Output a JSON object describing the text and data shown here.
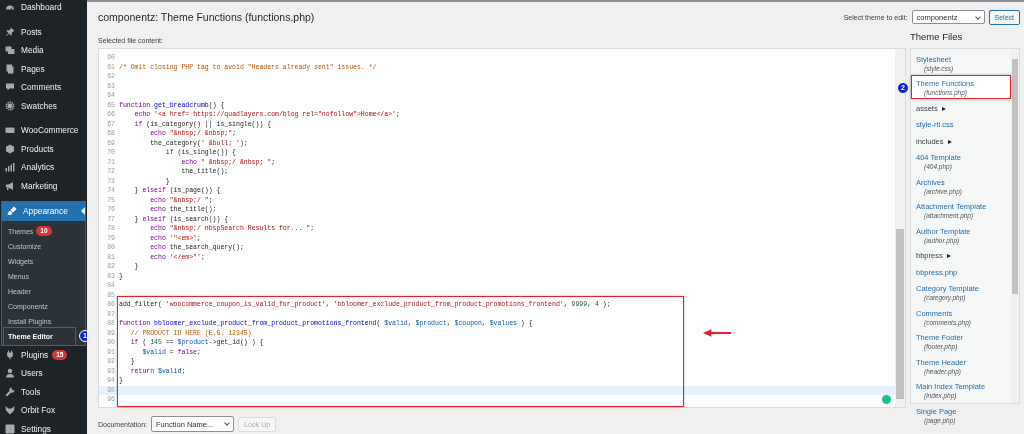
{
  "sidebar": {
    "menu_groups": [
      {
        "items": [
          {
            "label": "Dashboard",
            "current": false
          }
        ]
      },
      {
        "items": [
          {
            "label": "Posts",
            "current": false
          },
          {
            "label": "Media",
            "current": false
          },
          {
            "label": "Pages",
            "current": false
          },
          {
            "label": "Comments",
            "current": false
          },
          {
            "label": "Swatches",
            "current": false
          }
        ]
      },
      {
        "items": [
          {
            "label": "WooCommerce",
            "current": false
          },
          {
            "label": "Products",
            "current": false
          },
          {
            "label": "Analytics",
            "current": false
          },
          {
            "label": "Marketing",
            "current": false
          }
        ]
      },
      {
        "items": [
          {
            "label": "Appearance",
            "current": true,
            "framed": true,
            "children": [
              {
                "label": "Themes",
                "badge": "10",
                "selected": false
              },
              {
                "label": "Customize",
                "selected": false
              },
              {
                "label": "Widgets",
                "selected": false
              },
              {
                "label": "Menus",
                "selected": false
              },
              {
                "label": "Header",
                "selected": false
              },
              {
                "label": "Componentz",
                "selected": false
              },
              {
                "label": "Install Plugins",
                "selected": false
              },
              {
                "label": "Theme Editor",
                "selected": true,
                "annotation_badge": "1"
              }
            ]
          },
          {
            "label": "Plugins",
            "badge": "15",
            "current": false
          },
          {
            "label": "Users",
            "current": false
          },
          {
            "label": "Tools",
            "current": false
          },
          {
            "label": "Orbit Fox",
            "current": false
          },
          {
            "label": "Settings",
            "current": false
          }
        ]
      }
    ]
  },
  "page": {
    "title": "componentz: Theme Functions (functions.php)",
    "theme_select": {
      "label": "Select theme to edit:",
      "value": "componentz",
      "button": "Select"
    }
  },
  "editor": {
    "label": "Selected file content:",
    "lines": [
      {
        "number": "60",
        "active": false,
        "framed": false
      },
      {
        "number": "61",
        "active": false,
        "framed": false,
        "tokens": [
          {
            "kind": "comment",
            "text": "/* Omit closing PHP tag to avoid \"Headers already sent\" issues. */"
          }
        ]
      },
      {
        "number": "62",
        "active": false,
        "framed": false
      },
      {
        "number": "63",
        "active": false,
        "framed": false
      },
      {
        "number": "64",
        "active": false,
        "framed": false
      },
      {
        "number": "65",
        "active": false,
        "framed": false,
        "tokens": [
          {
            "kind": "keyword",
            "text": "function"
          },
          {
            "kind": "def",
            "text": " get_breadcrumb"
          },
          {
            "kind": "plain",
            "text": "() {"
          }
        ]
      },
      {
        "number": "66",
        "active": false,
        "framed": false,
        "tokens": [
          {
            "kind": "keyword",
            "text": "    echo"
          },
          {
            "kind": "string",
            "text": " '<a href= https://quadlayers.com/blog rel=\"nofollow\">Home</a>'"
          },
          {
            "kind": "plain",
            "text": ";"
          }
        ]
      },
      {
        "number": "67",
        "active": false,
        "framed": false,
        "tokens": [
          {
            "kind": "keyword",
            "text": "    if"
          },
          {
            "kind": "plain",
            "text": " (is_category() || is_single()) {"
          }
        ]
      },
      {
        "number": "68",
        "active": false,
        "framed": false,
        "tokens": [
          {
            "kind": "keyword",
            "text": "        echo"
          },
          {
            "kind": "string",
            "text": " \"&nbsp;/ &nbsp;\""
          },
          {
            "kind": "plain",
            "text": ";"
          }
        ]
      },
      {
        "number": "69",
        "active": false,
        "framed": false,
        "tokens": [
          {
            "kind": "plain",
            "text": "        the_category("
          },
          {
            "kind": "string",
            "text": "' &bull; '"
          },
          {
            "kind": "plain",
            "text": ");"
          }
        ]
      },
      {
        "number": "70",
        "active": false,
        "framed": false,
        "tokens": [
          {
            "kind": "keyword",
            "text": "            if"
          },
          {
            "kind": "plain",
            "text": " (is_single()) {"
          }
        ]
      },
      {
        "number": "71",
        "active": false,
        "framed": false,
        "tokens": [
          {
            "kind": "keyword",
            "text": "                echo"
          },
          {
            "kind": "string",
            "text": " \" &nbsp;/ &nbsp; \""
          },
          {
            "kind": "plain",
            "text": ";"
          }
        ]
      },
      {
        "number": "72",
        "active": false,
        "framed": false,
        "tokens": [
          {
            "kind": "plain",
            "text": "                the_title();"
          }
        ]
      },
      {
        "number": "73",
        "active": false,
        "framed": false,
        "tokens": [
          {
            "kind": "plain",
            "text": "            }"
          }
        ]
      },
      {
        "number": "74",
        "active": false,
        "framed": false,
        "tokens": [
          {
            "kind": "plain",
            "text": "    } "
          },
          {
            "kind": "keyword",
            "text": "elseif"
          },
          {
            "kind": "plain",
            "text": " (is_page()) {"
          }
        ]
      },
      {
        "number": "75",
        "active": false,
        "framed": false,
        "tokens": [
          {
            "kind": "keyword",
            "text": "        echo"
          },
          {
            "kind": "string",
            "text": " \"&nbsp;/ \""
          },
          {
            "kind": "plain",
            "text": ";"
          }
        ]
      },
      {
        "number": "76",
        "active": false,
        "framed": false,
        "tokens": [
          {
            "kind": "keyword",
            "text": "        echo"
          },
          {
            "kind": "plain",
            "text": " the_title();"
          }
        ]
      },
      {
        "number": "77",
        "active": false,
        "framed": false,
        "tokens": [
          {
            "kind": "plain",
            "text": "    } "
          },
          {
            "kind": "keyword",
            "text": "elseif"
          },
          {
            "kind": "plain",
            "text": " (is_search()) {"
          }
        ]
      },
      {
        "number": "78",
        "active": false,
        "framed": false,
        "tokens": [
          {
            "kind": "keyword",
            "text": "        echo"
          },
          {
            "kind": "string",
            "text": " \"&nbsp;/ nbspSearch Results for... \""
          },
          {
            "kind": "plain",
            "text": ";"
          }
        ]
      },
      {
        "number": "79",
        "active": false,
        "framed": false,
        "tokens": [
          {
            "kind": "keyword",
            "text": "        echo"
          },
          {
            "kind": "string",
            "text": " '\"<em>'"
          },
          {
            "kind": "plain",
            "text": ";"
          }
        ]
      },
      {
        "number": "80",
        "active": false,
        "framed": false,
        "tokens": [
          {
            "kind": "keyword",
            "text": "        echo"
          },
          {
            "kind": "plain",
            "text": " the_search_query();"
          }
        ]
      },
      {
        "number": "81",
        "active": false,
        "framed": false,
        "tokens": [
          {
            "kind": "keyword",
            "text": "        echo"
          },
          {
            "kind": "string",
            "text": " '</em>\"'"
          },
          {
            "kind": "plain",
            "text": ";"
          }
        ]
      },
      {
        "number": "82",
        "active": false,
        "framed": false,
        "tokens": [
          {
            "kind": "plain",
            "text": "    }"
          }
        ]
      },
      {
        "number": "83",
        "active": false,
        "framed": false,
        "tokens": [
          {
            "kind": "plain",
            "text": "}"
          }
        ]
      },
      {
        "number": "84",
        "active": false,
        "framed": false
      },
      {
        "number": "85",
        "active": false,
        "framed": false
      },
      {
        "number": "86",
        "active": false,
        "framed": true,
        "tokens": [
          {
            "kind": "plain",
            "text": "add_filter( "
          },
          {
            "kind": "string",
            "text": "'woocommerce_coupon_is_valid_for_product'"
          },
          {
            "kind": "plain",
            "text": ", "
          },
          {
            "kind": "string",
            "text": "'bbloomer_exclude_product_from_product_promotions_frontend'"
          },
          {
            "kind": "plain",
            "text": ", "
          },
          {
            "kind": "number",
            "text": "9999"
          },
          {
            "kind": "plain",
            "text": ", "
          },
          {
            "kind": "number",
            "text": "4"
          },
          {
            "kind": "plain",
            "text": " );"
          }
        ]
      },
      {
        "number": "87",
        "active": false,
        "framed": true
      },
      {
        "number": "88",
        "active": false,
        "framed": true,
        "tokens": [
          {
            "kind": "keyword",
            "text": "function"
          },
          {
            "kind": "def",
            "text": " bbloomer_exclude_product_from_product_promotions_frontend"
          },
          {
            "kind": "plain",
            "text": "( "
          },
          {
            "kind": "variable",
            "text": "$valid"
          },
          {
            "kind": "plain",
            "text": ", "
          },
          {
            "kind": "variable",
            "text": "$product"
          },
          {
            "kind": "plain",
            "text": ", "
          },
          {
            "kind": "variable",
            "text": "$coupon"
          },
          {
            "kind": "plain",
            "text": ", "
          },
          {
            "kind": "variable",
            "text": "$values"
          },
          {
            "kind": "plain",
            "text": " ) {"
          }
        ]
      },
      {
        "number": "89",
        "active": false,
        "framed": true,
        "tokens": [
          {
            "kind": "comment",
            "text": "   // PRODUCT ID HERE (E.G. 12345)"
          }
        ]
      },
      {
        "number": "90",
        "active": false,
        "framed": true,
        "tokens": [
          {
            "kind": "keyword",
            "text": "   if"
          },
          {
            "kind": "plain",
            "text": " ( "
          },
          {
            "kind": "number",
            "text": "145"
          },
          {
            "kind": "plain",
            "text": " == "
          },
          {
            "kind": "variable",
            "text": "$product"
          },
          {
            "kind": "plain",
            "text": "->get_id() ) {"
          }
        ]
      },
      {
        "number": "91",
        "active": false,
        "framed": true,
        "tokens": [
          {
            "kind": "variable",
            "text": "      $valid"
          },
          {
            "kind": "plain",
            "text": " = "
          },
          {
            "kind": "keyword",
            "text": "false"
          },
          {
            "kind": "plain",
            "text": ";"
          }
        ]
      },
      {
        "number": "92",
        "active": false,
        "framed": true,
        "tokens": [
          {
            "kind": "plain",
            "text": "   }"
          }
        ]
      },
      {
        "number": "93",
        "active": false,
        "framed": true,
        "tokens": [
          {
            "kind": "keyword",
            "text": "   return"
          },
          {
            "kind": "variable",
            "text": " $valid"
          },
          {
            "kind": "plain",
            "text": ";"
          }
        ]
      },
      {
        "number": "94",
        "active": false,
        "framed": true,
        "tokens": [
          {
            "kind": "plain",
            "text": "}"
          }
        ]
      },
      {
        "number": "95",
        "active": true,
        "framed": true
      },
      {
        "number": "96",
        "active": false,
        "framed": true
      }
    ]
  },
  "documentation": {
    "label": "Documentation:",
    "select_value": "Function Name...",
    "button": "Look Up",
    "button_disabled": true
  },
  "theme_files": {
    "heading": "Theme Files",
    "items": [
      {
        "kind": "file",
        "name": "Stylesheet",
        "filename": "(style.css)",
        "selected": false
      },
      {
        "kind": "file",
        "name": "Theme Functions",
        "filename": "(functions.php)",
        "selected": true,
        "annotation_badge": "2"
      },
      {
        "kind": "folder",
        "name": "assets",
        "selected": false
      },
      {
        "kind": "file",
        "name": "style-rtl.css",
        "selected": false
      },
      {
        "kind": "folder",
        "name": "includes",
        "selected": false
      },
      {
        "kind": "file",
        "name": "404 Template",
        "filename": "(404.php)",
        "selected": false
      },
      {
        "kind": "file",
        "name": "Archives",
        "filename": "(archive.php)",
        "selected": false
      },
      {
        "kind": "file",
        "name": "Attachment Template",
        "filename": "(attachment.php)",
        "selected": false
      },
      {
        "kind": "file",
        "name": "Author Template",
        "filename": "(author.php)",
        "selected": false
      },
      {
        "kind": "folder",
        "name": "bbpress",
        "selected": false
      },
      {
        "kind": "file",
        "name": "bbpress.php",
        "selected": false
      },
      {
        "kind": "file",
        "name": "Category Template",
        "filename": "(category.php)",
        "selected": false
      },
      {
        "kind": "file",
        "name": "Comments",
        "filename": "(comments.php)",
        "selected": false
      },
      {
        "kind": "file",
        "name": "Theme Footer",
        "filename": "(footer.php)",
        "selected": false
      },
      {
        "kind": "file",
        "name": "Theme Header",
        "filename": "(header.php)",
        "selected": false
      },
      {
        "kind": "file",
        "name": "Main Index Template",
        "filename": "(index.php)",
        "selected": false
      },
      {
        "kind": "file",
        "name": "Single Page",
        "filename": "(page.php)",
        "selected": false
      }
    ]
  }
}
